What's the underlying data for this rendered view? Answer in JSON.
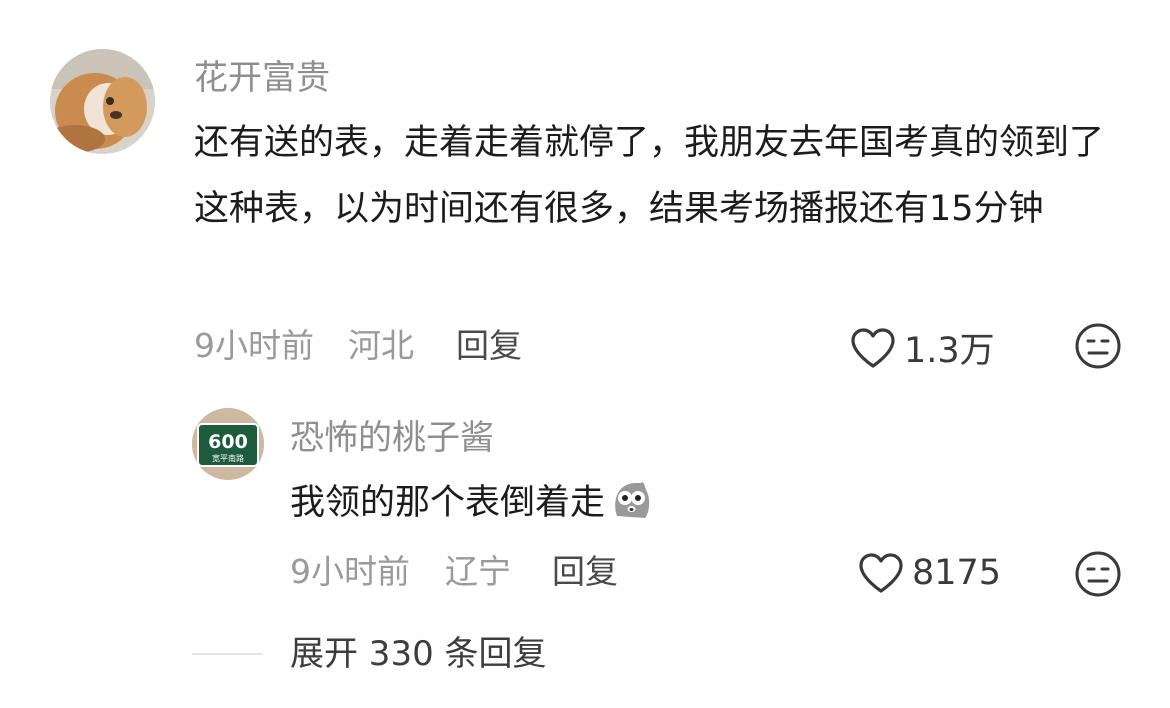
{
  "comment": {
    "username": "花开富贵",
    "text": "还有送的表，走着走着就停了，我朋友去年国考真的领到了这种表，以为时间还有很多，结果考场播报还有15分钟",
    "time": "9小时前",
    "location": "河北",
    "reply_label": "回复",
    "likes": "1.3万",
    "avatar_icon": "dog-avatar"
  },
  "reply": {
    "username": "恐怖的桃子酱",
    "text": "我领的那个表倒着走",
    "emoji_icon": "shocked-pigeon-emoji",
    "time": "9小时前",
    "location": "辽宁",
    "reply_label": "回复",
    "likes": "8175",
    "avatar_sign_number": "600",
    "avatar_sign_text": "宽平南路",
    "avatar_icon": "street-sign-avatar"
  },
  "expand": {
    "label": "展开 330 条回复"
  },
  "colors": {
    "username": "#8f8f8f",
    "meta": "#9a9a9a",
    "text": "#1c1c1c",
    "sign_green": "#1e5a3c"
  }
}
